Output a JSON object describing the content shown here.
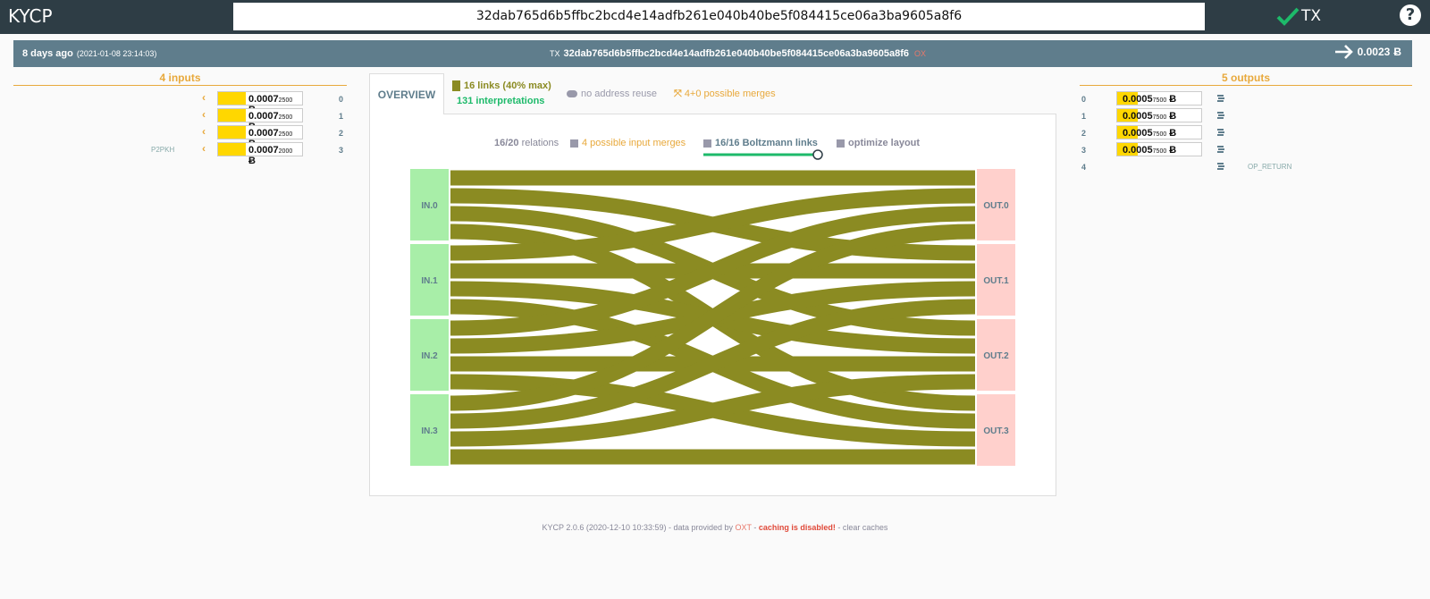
{
  "app": {
    "title": "KYCP"
  },
  "search": {
    "value": "32dab765d6b5ffbc2bcd4e14adfb261e040b40be5f084415ce06a3ba9605a8f6"
  },
  "tx_badge": {
    "label": "TX"
  },
  "help": {
    "label": "?"
  },
  "info": {
    "age": "8 days ago",
    "timestamp": "(2021-01-08 23:14:03)",
    "tx_prefix": "TX",
    "txid": "32dab765d6b5ffbc2bcd4e14adfb261e040b40be5f084415ce06a3ba9605a8f6",
    "oxt": "OX",
    "total": "0.0023",
    "unit": "Ƀ"
  },
  "inputs": {
    "title": "4 inputs",
    "items": [
      {
        "index": "0",
        "amount_main": "0.0007",
        "amount_small": "2500",
        "unit": "Ƀ",
        "type": "",
        "fill": 0.32
      },
      {
        "index": "1",
        "amount_main": "0.0007",
        "amount_small": "2500",
        "unit": "Ƀ",
        "type": "",
        "fill": 0.32
      },
      {
        "index": "2",
        "amount_main": "0.0007",
        "amount_small": "2500",
        "unit": "Ƀ",
        "type": "",
        "fill": 0.32
      },
      {
        "index": "3",
        "amount_main": "0.0007",
        "amount_small": "2000",
        "unit": "Ƀ",
        "type": "P2PKH",
        "fill": 0.32
      }
    ]
  },
  "outputs": {
    "title": "5 outputs",
    "items": [
      {
        "index": "0",
        "amount_main": "0.0005",
        "amount_small": "7500",
        "unit": "Ƀ",
        "type": "",
        "fill": 0.24
      },
      {
        "index": "1",
        "amount_main": "0.0005",
        "amount_small": "7500",
        "unit": "Ƀ",
        "type": "",
        "fill": 0.24
      },
      {
        "index": "2",
        "amount_main": "0.0005",
        "amount_small": "7500",
        "unit": "Ƀ",
        "type": "",
        "fill": 0.24
      },
      {
        "index": "3",
        "amount_main": "0.0005",
        "amount_small": "7500",
        "unit": "Ƀ",
        "type": "",
        "fill": 0.24
      },
      {
        "index": "4",
        "amount_main": "",
        "amount_small": "",
        "unit": "",
        "type": "OP_RETURN",
        "fill": 0
      }
    ]
  },
  "overview": {
    "tab_label": "OVERVIEW",
    "links": "16 links (40% max)",
    "interpretations": "131 interpretations",
    "address_reuse": "no address reuse",
    "merges": "4+0 possible merges"
  },
  "controls": {
    "relations": "16/20",
    "relations_label": "relations",
    "input_merges": "4 possible input merges",
    "boltzmann": "16/16 Boltzmann links",
    "optimize": "optimize layout",
    "slider_level": 1.0
  },
  "diagram": {
    "inputs": [
      "IN.0",
      "IN.1",
      "IN.2",
      "IN.3"
    ],
    "outputs": [
      "OUT.0",
      "OUT.1",
      "OUT.2",
      "OUT.3"
    ],
    "colors": {
      "link": "#8b8b22",
      "input": "#a8eea8",
      "output": "#ffd0cc"
    }
  },
  "footer": {
    "version": "KYCP 2.0.6 (2020-12-10 10:33:59) - data provided by ",
    "oxt": "OXT",
    "sep": " - ",
    "caching": "caching is disabled!",
    "clear": " - clear caches"
  },
  "colors": {
    "accent": "#e8a93c",
    "topbar": "#2e3d45",
    "infobar": "#5f7d8c",
    "green": "#1dba6a",
    "yellow": "#ffd700"
  }
}
